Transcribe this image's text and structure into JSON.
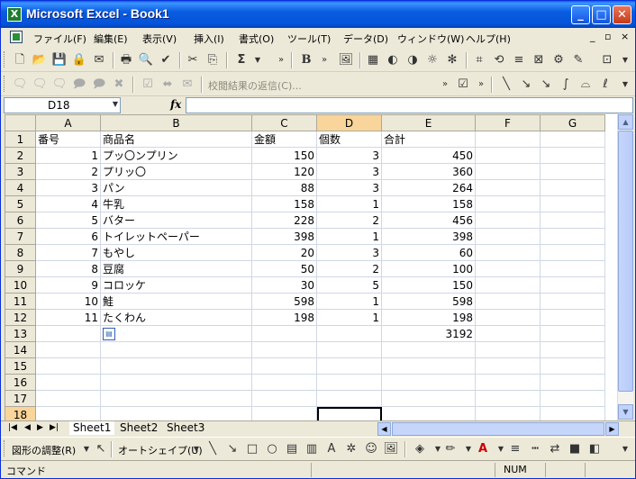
{
  "window": {
    "title": "Microsoft Excel - Book1",
    "app_icon": "X",
    "controls": {
      "minimize": "_",
      "maximize": "□",
      "close": "✕"
    }
  },
  "menu": {
    "items": [
      "ファイル(F)",
      "編集(E)",
      "表示(V)",
      "挿入(I)",
      "書式(O)",
      "ツール(T)",
      "データ(D)",
      "ウィンドウ(W)",
      "ヘルプ(H)"
    ],
    "doc_controls": [
      "_",
      "▫",
      "×"
    ]
  },
  "toolbar1": {
    "icons": [
      "new-icon",
      "open-icon",
      "save-icon",
      "permission-icon",
      "email-icon",
      "print-icon",
      "print-preview-icon",
      "spelling-icon",
      "cut-icon",
      "copy-icon",
      "autosum-icon",
      "bold-icon",
      "picture-icon"
    ],
    "autosum_label": "Σ",
    "bold_label": "B"
  },
  "toolbar2": {
    "reply_text": "校閲結果の返信(C)..."
  },
  "formula_bar": {
    "name_box": "D18",
    "fx_label": "fx",
    "formula": ""
  },
  "sheet": {
    "columns": [
      "A",
      "B",
      "C",
      "D",
      "E",
      "F",
      "G"
    ],
    "rows": [
      {
        "n": "1",
        "A": "番号",
        "B": "商品名",
        "C": "金額",
        "D": "個数",
        "E": "合計"
      },
      {
        "n": "2",
        "A": "1",
        "B": "プッ〇ンプリン",
        "C": "150",
        "D": "3",
        "E": "450"
      },
      {
        "n": "3",
        "A": "2",
        "B": "プリッ〇",
        "C": "120",
        "D": "3",
        "E": "360"
      },
      {
        "n": "4",
        "A": "3",
        "B": "パン",
        "C": "88",
        "D": "3",
        "E": "264"
      },
      {
        "n": "5",
        "A": "4",
        "B": "牛乳",
        "C": "158",
        "D": "1",
        "E": "158"
      },
      {
        "n": "6",
        "A": "5",
        "B": "バター",
        "C": "228",
        "D": "2",
        "E": "456"
      },
      {
        "n": "7",
        "A": "6",
        "B": "トイレットペーパー",
        "C": "398",
        "D": "1",
        "E": "398"
      },
      {
        "n": "8",
        "A": "7",
        "B": "もやし",
        "C": "20",
        "D": "3",
        "E": "60"
      },
      {
        "n": "9",
        "A": "8",
        "B": "豆腐",
        "C": "50",
        "D": "2",
        "E": "100"
      },
      {
        "n": "10",
        "A": "9",
        "B": "コロッケ",
        "C": "30",
        "D": "5",
        "E": "150"
      },
      {
        "n": "11",
        "A": "10",
        "B": "鮭",
        "C": "598",
        "D": "1",
        "E": "598"
      },
      {
        "n": "12",
        "A": "11",
        "B": "たくわん",
        "C": "198",
        "D": "1",
        "E": "198"
      },
      {
        "n": "13",
        "A": "",
        "B": "",
        "C": "",
        "D": "",
        "E": "3192"
      },
      {
        "n": "14",
        "A": "",
        "B": "",
        "C": "",
        "D": "",
        "E": ""
      },
      {
        "n": "15",
        "A": "",
        "B": "",
        "C": "",
        "D": "",
        "E": ""
      },
      {
        "n": "16",
        "A": "",
        "B": "",
        "C": "",
        "D": "",
        "E": ""
      },
      {
        "n": "17",
        "A": "",
        "B": "",
        "C": "",
        "D": "",
        "E": ""
      },
      {
        "n": "18",
        "A": "",
        "B": "",
        "C": "",
        "D": "",
        "E": ""
      }
    ],
    "active_cell": "D18"
  },
  "tabs": {
    "sheets": [
      "Sheet1",
      "Sheet2",
      "Sheet3"
    ],
    "active": "Sheet1"
  },
  "drawing_toolbar": {
    "draw_menu": "図形の調整(R)",
    "autoshape_menu": "オートシェイプ(U)"
  },
  "status": {
    "text": "コマンド",
    "num": "NUM"
  }
}
